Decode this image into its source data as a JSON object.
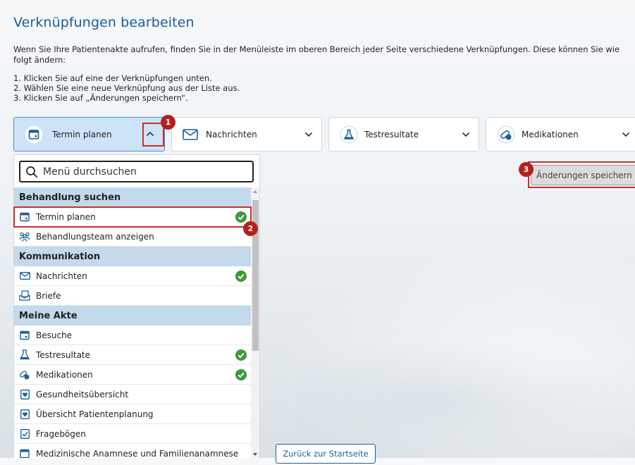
{
  "page": {
    "title": "Verknüpfungen bearbeiten",
    "intro": "Wenn Sie Ihre Patientenakte aufrufen, finden Sie in der Menüleiste im oberen Bereich jeder Seite verschiedene Verknüpfungen. Diese können Sie wie folgt ändern:",
    "steps": [
      "1. Klicken Sie auf eine der Verknüpfungen unten.",
      "2. Wählen Sie eine neue Verknüpfung aus der Liste aus.",
      "3. Klicken Sie auf „Änderungen speichern“."
    ]
  },
  "shortcuts": [
    {
      "label": "Termin planen",
      "icon": "calendar-icon",
      "active": true
    },
    {
      "label": "Nachrichten",
      "icon": "envelope-icon",
      "active": false
    },
    {
      "label": "Testresultate",
      "icon": "flask-icon",
      "active": false
    },
    {
      "label": "Medikationen",
      "icon": "pills-icon",
      "active": false
    }
  ],
  "markers": [
    "1",
    "2",
    "3"
  ],
  "dropdown": {
    "search_placeholder": "Menü durchsuchen",
    "categories": [
      {
        "name": "Behandlung suchen",
        "items": [
          {
            "label": "Termin planen",
            "icon": "calendar-icon",
            "checked": true
          },
          {
            "label": "Behandlungsteam anzeigen",
            "icon": "team-icon",
            "checked": false
          }
        ]
      },
      {
        "name": "Kommunikation",
        "items": [
          {
            "label": "Nachrichten",
            "icon": "envelope-icon",
            "checked": true
          },
          {
            "label": "Briefe",
            "icon": "letters-icon",
            "checked": false
          }
        ]
      },
      {
        "name": "Meine Akte",
        "items": [
          {
            "label": "Besuche",
            "icon": "calendar-icon",
            "checked": false
          },
          {
            "label": "Testresultate",
            "icon": "flask-icon",
            "checked": true
          },
          {
            "label": "Medikationen",
            "icon": "pills-icon",
            "checked": true
          },
          {
            "label": "Gesundheitsübersicht",
            "icon": "health-summary-icon",
            "checked": false
          },
          {
            "label": "Übersicht Patientenplanung",
            "icon": "health-summary-icon",
            "checked": false
          },
          {
            "label": "Fragebögen",
            "icon": "checklist-icon",
            "checked": false
          },
          {
            "label": "Medizinische Anamnese und Familienanamnese",
            "icon": "calendar-icon",
            "checked": false
          }
        ]
      }
    ]
  },
  "buttons": {
    "save": "Änderungen speichern",
    "home": "Zurück zur Startseite"
  },
  "colors": {
    "accent": "#1a5f99",
    "active_shortcut_bg": "#cde3f7",
    "category_bg": "#c5d9ec",
    "check_green": "#3a9a3a",
    "marker_red": "#b51f1f"
  }
}
